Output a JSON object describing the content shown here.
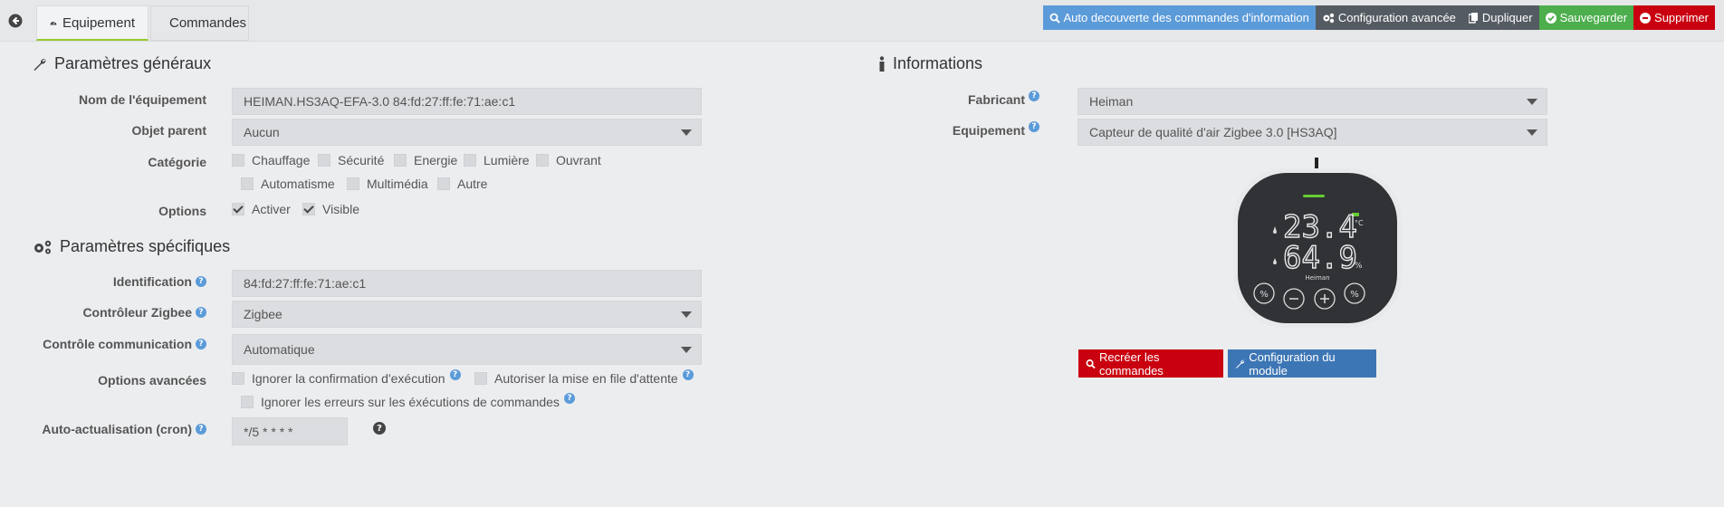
{
  "tabs": {
    "equipement": "Equipement",
    "commandes": "Commandes"
  },
  "actions": {
    "auto_discovery": "Auto decouverte des commandes d'information",
    "advanced_config": "Configuration avancée",
    "duplicate": "Dupliquer",
    "save": "Sauvegarder",
    "delete": "Supprimer"
  },
  "general": {
    "title": "Paramètres généraux",
    "name_label": "Nom de l'équipement",
    "name_value": "HEIMAN.HS3AQ-EFA-3.0 84:fd:27:ff:fe:71:ae:c1",
    "parent_label": "Objet parent",
    "parent_value": "Aucun",
    "category_label": "Catégorie",
    "categories": [
      "Chauffage",
      "Sécurité",
      "Energie",
      "Lumière",
      "Ouvrant",
      "Automatisme",
      "Multimédia",
      "Autre"
    ],
    "options_label": "Options",
    "options": [
      "Activer",
      "Visible"
    ]
  },
  "specific": {
    "title": "Paramètres spécifiques",
    "id_label": "Identification",
    "id_value": "84:fd:27:ff:fe:71:ae:c1",
    "controller_label": "Contrôleur Zigbee",
    "controller_value": "Zigbee",
    "comm_label": "Contrôle communication",
    "comm_value": "Automatique",
    "adv_label": "Options avancées",
    "adv_options": [
      "Ignorer la confirmation d'exécution",
      "Autoriser la mise en file d'attente",
      "Ignorer les erreurs sur les éxécutions de commandes"
    ],
    "cron_label": "Auto-actualisation (cron)",
    "cron_value": "*/5 * * * *"
  },
  "info": {
    "title": "Informations",
    "maker_label": "Fabricant",
    "maker_value": "Heiman",
    "device_label": "Equipement",
    "device_value": "Capteur de qualité d'air Zigbee 3.0 [HS3AQ]",
    "display_temp": "23.4",
    "display_hum": "64.9",
    "display_unit_temp": "°C",
    "display_unit_hum": "%",
    "brand": "Heiman",
    "recreate": "Recréer les commandes",
    "module_config": "Configuration du module"
  },
  "colors": {
    "accent_green": "#94ca2c",
    "blue": "#5b9bd9",
    "dark": "#555b62",
    "green": "#4cae4c",
    "red": "#c9000f"
  }
}
